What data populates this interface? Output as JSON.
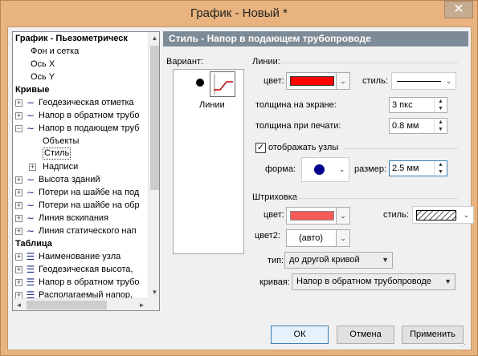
{
  "window": {
    "title": "График - Новый *",
    "close_label": "✕"
  },
  "tree": {
    "rows": [
      {
        "label": "График - Пьезометрическ",
        "level": 0,
        "header": true
      },
      {
        "label": "Фон и сетка",
        "level": 1
      },
      {
        "label": "Ось X",
        "level": 1
      },
      {
        "label": "Ось Y",
        "level": 1
      },
      {
        "label": "Кривые",
        "level": 0,
        "header": true
      },
      {
        "label": "Геодезическая отметка",
        "level": 1,
        "expander": "+",
        "icon": "curve"
      },
      {
        "label": "Напор в обратном трубо",
        "level": 1,
        "expander": "+",
        "icon": "curve"
      },
      {
        "label": "Напор в подающем труб",
        "level": 1,
        "expander": "−",
        "icon": "curve"
      },
      {
        "label": "Объекты",
        "level": 2
      },
      {
        "label": "Стиль",
        "level": 2,
        "selected": true
      },
      {
        "label": "Надписи",
        "level": 2,
        "expander": "+"
      },
      {
        "label": "Высота зданий",
        "level": 1,
        "expander": "+",
        "icon": "curve"
      },
      {
        "label": "Потери на шайбе на под",
        "level": 1,
        "expander": "+",
        "icon": "curve"
      },
      {
        "label": "Потери на шайбе на обр",
        "level": 1,
        "expander": "+",
        "icon": "curve"
      },
      {
        "label": "Линия вскипания",
        "level": 1,
        "expander": "+",
        "icon": "curve"
      },
      {
        "label": "Линия статического нап",
        "level": 1,
        "expander": "+",
        "icon": "curve"
      },
      {
        "label": "Таблица",
        "level": 0,
        "header": true
      },
      {
        "label": "Наименование узла",
        "level": 1,
        "expander": "+",
        "icon": "table"
      },
      {
        "label": "Геодезическая высота,",
        "level": 1,
        "expander": "+",
        "icon": "table"
      },
      {
        "label": "Напор в обратном трубо",
        "level": 1,
        "expander": "+",
        "icon": "table"
      },
      {
        "label": "Располагаемый напор,",
        "level": 1,
        "expander": "+",
        "icon": "table"
      }
    ]
  },
  "panel": {
    "title": "Стиль - Напор в подающем трубопроводе",
    "variant_label": "Вариант:",
    "variant_item": "Линии",
    "lines": {
      "group_label": "Линии:",
      "color_label": "цвет:",
      "color": "#ff0000",
      "style_label": "стиль:",
      "thickness_screen_label": "толщина на экране:",
      "thickness_screen_value": "3 пкс",
      "thickness_print_label": "толщина при печати:",
      "thickness_print_value": "0.8 мм"
    },
    "nodes": {
      "checkbox_label": "отображать узлы",
      "checked": true,
      "shape_label": "форма:",
      "size_label": "размер:",
      "size_value": "2.5 мм",
      "marker_color": "#00008b"
    },
    "hatch": {
      "group_label": "Штриховка",
      "color_label": "цвет:",
      "color": "#f85a5a",
      "style_label": "стиль:",
      "color2_label": "цвет2:",
      "color2_value": "(авто)",
      "type_label": "тип:",
      "type_value": "до другой кривой",
      "curve_label": "кривая:",
      "curve_value": "Напор в обратном трубопроводе"
    }
  },
  "buttons": {
    "ok": "ОК",
    "cancel": "Отмена",
    "apply": "Применить"
  }
}
